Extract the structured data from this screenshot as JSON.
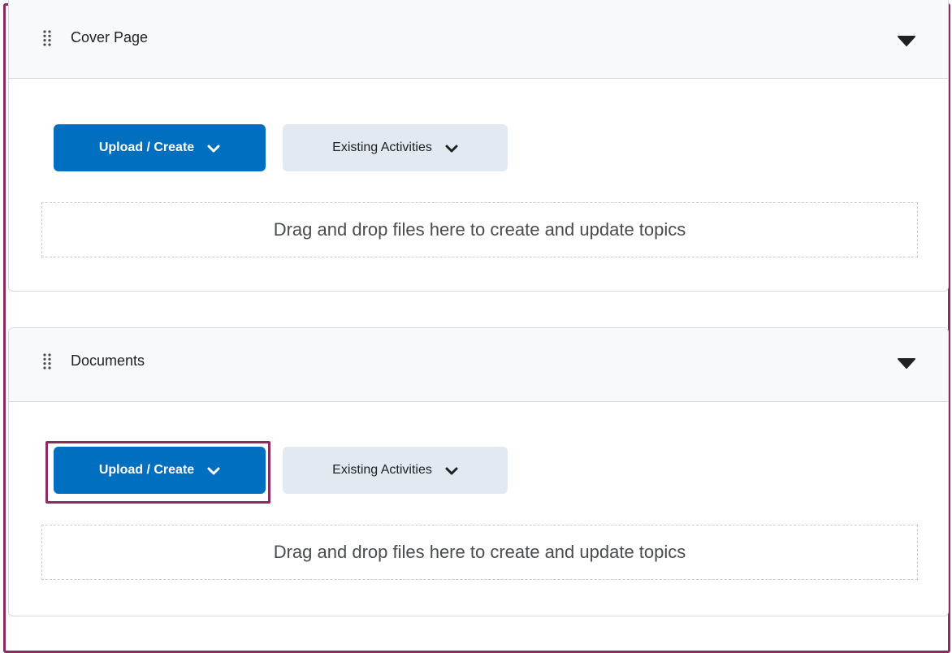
{
  "modules": [
    {
      "title": "Cover Page",
      "upload_label": "Upload / Create",
      "existing_label": "Existing Activities",
      "dropzone_text": "Drag and drop files here to create and update topics"
    },
    {
      "title": "Documents",
      "upload_label": "Upload / Create",
      "existing_label": "Existing Activities",
      "dropzone_text": "Drag and drop files here to create and update topics"
    }
  ],
  "icons": {
    "drag_handle": "drag-handle-icon",
    "collapse": "caret-down-icon",
    "chevron": "chevron-down-icon"
  },
  "colors": {
    "primary": "#006fbf",
    "secondary": "#e3e9f1",
    "highlight": "#8b2b5e"
  }
}
